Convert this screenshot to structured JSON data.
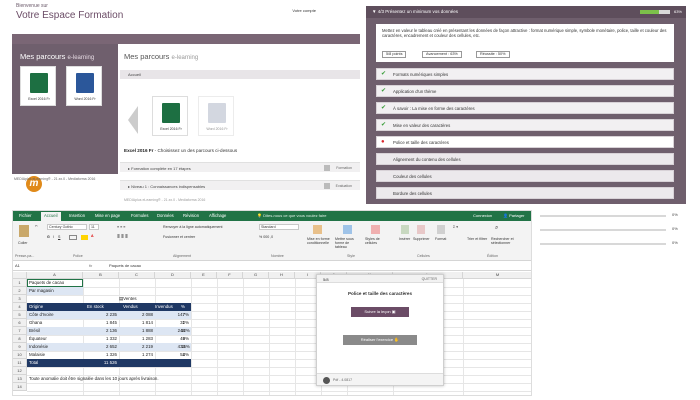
{
  "portal": {
    "welcome_small": "Bienvenue sur",
    "welcome_big": "Votre Espace Formation",
    "account_link": "Votre compte",
    "account_link2": "",
    "left_title": "Mes parcours",
    "left_title_small": "e-learning",
    "tiles": [
      {
        "label": "Excel 2016 Fr",
        "color": "#1d6f42"
      },
      {
        "label": "Word 2016 Fr",
        "color": "#2b579a"
      }
    ],
    "logo_text": "MEDIAplus eLearning",
    "left_footer": "MEDIAplus eLearning® - 21.xx.0 - Mediaforma 2016",
    "right_title": "Mes parcours",
    "right_title_small": "e-learning",
    "breadcrumb": "Accueil",
    "right_tiles": [
      {
        "label": "Excel 2016 Fr",
        "color": "#1d6f42"
      },
      {
        "label": "Word 2016 Fr",
        "color": "#b0b8c8"
      }
    ],
    "course_name": "Excel 2016 Fr",
    "course_hint": " - Choisissez un des parcours ci-dessous",
    "rows": [
      {
        "label": "Formation complète en 17 étapes",
        "action": "Formation"
      },
      {
        "label": "Niveau 1 : Connaissances indispensables",
        "action": "Evaluation"
      }
    ],
    "right_footer": "MEDIAplus eLearning® - 21.xx.0 - Mediaforma 2016"
  },
  "checklist": {
    "header": "4/3 Présentez un minimum vos données",
    "progress_pct": 63,
    "progress_label": "63%",
    "description": "Mettez en valeur le tableau créé en présentant les données de façon attractive : format numérique simple, symbole monétaire, police, taille et couleur des caractères, encadrement et couleur des cellules, etc.",
    "stats": [
      "5/8 points",
      "Avancement : 63%",
      "Réussite : 50%"
    ],
    "items": [
      {
        "label": "Formats numériques simples",
        "state": "done"
      },
      {
        "label": "Application d'un thème",
        "state": "done"
      },
      {
        "label": "À savoir : La mise en forme des caractères",
        "state": "done"
      },
      {
        "label": "Mise en valeur des caractères",
        "state": "done"
      },
      {
        "label": "Police et taille des caractères",
        "state": "current"
      },
      {
        "label": "Alignement du contenu des cellules",
        "state": "pending"
      },
      {
        "label": "Couleur des cellules",
        "state": "pending"
      },
      {
        "label": "Bordure des cellules",
        "state": "pending"
      }
    ],
    "done_mark": "✔",
    "current_mark": "●",
    "side_pcts": [
      "0%",
      "0%",
      "0%"
    ]
  },
  "excel": {
    "tabs": [
      "Fichier",
      "Accueil",
      "Insertion",
      "Mise en page",
      "Formules",
      "Données",
      "Révision",
      "Affichage"
    ],
    "active_tab": "Accueil",
    "tellme": "Dites-nous ce que vous voulez faire",
    "tab_right1": "Connexion",
    "tab_right2": "Partager",
    "ribbon": {
      "paste": "Coller",
      "font_name": "Century Gothic",
      "font_size": "11",
      "wrap": "Renvoyer à la ligne automatiquement",
      "merge": "Fusionner et centrer",
      "number_format": "Standard",
      "cond_format": "Mise en forme conditionnelle",
      "table_format": "Mettre sous forme de tableau",
      "cell_styles": "Styles de cellules",
      "insert": "Insérer",
      "delete": "Supprimer",
      "format": "Format",
      "sort": "Trier et filtrer",
      "find": "Rechercher et sélectionner",
      "groups": [
        "Presse-pa...",
        "Police",
        "Alignement",
        "Nombre",
        "Style",
        "Cellules",
        "Édition"
      ]
    },
    "namebox": "A1",
    "fx": "fx",
    "formula": "Paquets de cacao",
    "columns": [
      "A",
      "B",
      "C",
      "D",
      "E",
      "F",
      "G",
      "H",
      "I",
      "J",
      "K",
      "L",
      "M"
    ],
    "row_numbers": [
      "1",
      "2",
      "3",
      "4",
      "5",
      "6",
      "7",
      "8",
      "9",
      "10",
      "11",
      "12",
      "13",
      "14"
    ],
    "cells": {
      "title": "Paquets de cacao",
      "subtitle": "Par magasin",
      "unit_label": "Ventes",
      "headers": [
        "Origine",
        "En stock",
        "Vendus",
        "Invendus",
        "%"
      ],
      "rows": [
        [
          "Côte d'Ivoire",
          "2 235",
          "2 088",
          "147",
          "7%"
        ],
        [
          "Ghana",
          "1 845",
          "1 814",
          "31",
          "2%"
        ],
        [
          "Brésil",
          "2 136",
          "1 888",
          "248",
          "12%"
        ],
        [
          "Équateur",
          "1 332",
          "1 283",
          "49",
          "4%"
        ],
        [
          "Indonésie",
          "2 652",
          "2 219",
          "433",
          "16%"
        ],
        [
          "Malaisie",
          "1 326",
          "1 274",
          "52",
          "4%"
        ]
      ],
      "total_label": "Total",
      "total_value": "11 526",
      "note": "Toute anomalie doit être signalée dans les 10 jours après livraison."
    }
  },
  "dialog": {
    "step": "5/8",
    "quit": "QUITTER",
    "title": "Police et taille des caractères",
    "btn1": "Suivre la leçon",
    "btn2": "Réaliser l'exercice",
    "footer": "Pdf - 4.0817"
  }
}
